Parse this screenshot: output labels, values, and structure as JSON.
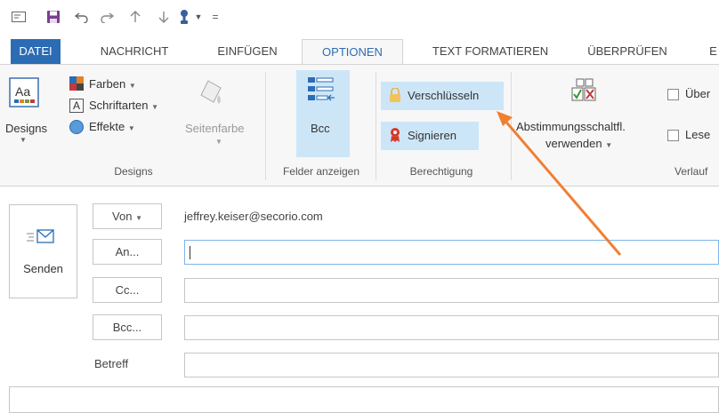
{
  "tabs": [
    {
      "label": "DATEI"
    },
    {
      "label": "NACHRICHT"
    },
    {
      "label": "EINFÜGEN"
    },
    {
      "label": "OPTIONEN"
    },
    {
      "label": "TEXT FORMATIEREN"
    },
    {
      "label": "ÜBERPRÜFEN"
    },
    {
      "label": "E"
    }
  ],
  "ribbon": {
    "designs": {
      "big_label": "Designs",
      "farben": "Farben",
      "schriftarten": "Schriftarten",
      "effekte": "Effekte",
      "seitenfarbe": "Seitenfarbe",
      "group": "Designs"
    },
    "felder": {
      "bcc": "Bcc",
      "group": "Felder anzeigen"
    },
    "berechtigung": {
      "verschluesseln": "Verschlüsseln",
      "signieren": "Signieren",
      "group": "Berechtigung"
    },
    "verlauf": {
      "abstimmung_line1": "Abstimmungsschaltfl.",
      "abstimmung_line2": "verwenden",
      "check1": "Über",
      "check2": "Lese",
      "group": "Verlauf"
    }
  },
  "compose": {
    "send_label": "Senden",
    "von_label": "Von",
    "from_address": "jeffrey.keiser@secorio.com",
    "an_label": "An...",
    "cc_label": "Cc...",
    "bcc_label": "Bcc...",
    "betreff_label": "Betreff"
  },
  "colors": {
    "accent": "#2b6cb4",
    "highlight": "#cde6f7",
    "arrow": "#f07f33"
  }
}
